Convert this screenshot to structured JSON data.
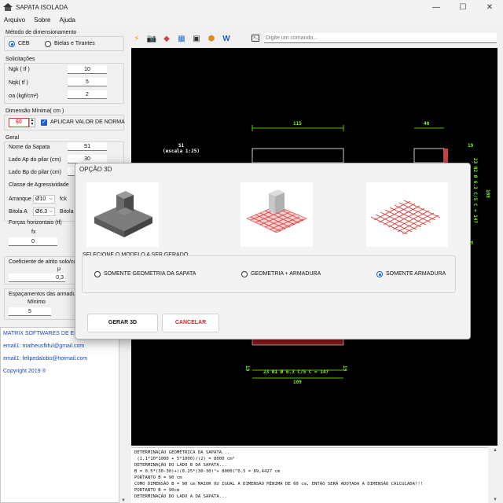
{
  "window": {
    "title": "SAPATA ISOLADA",
    "minimize": "—",
    "maximize": "☐",
    "close": "✕"
  },
  "menu": [
    "Arquivo",
    "Sobre",
    "Ajuda"
  ],
  "left": {
    "metodo": {
      "label": "Método de dimensionamento",
      "ceb": "CEB",
      "bielas": "Bielas e Tirantes",
      "selected": "CEB"
    },
    "solicitacoes": {
      "label": "Solicitações",
      "rows": [
        {
          "label": "Ngk ( tf )",
          "value": "10"
        },
        {
          "label": "Nqk( tf )",
          "value": "5"
        },
        {
          "label": "σa  (kgf/cm²)",
          "value": "2"
        }
      ]
    },
    "dimensao": {
      "label": "Dimensão Mínima( cm )",
      "value": "60",
      "checkbox": "APLICAR VALOR DE NORMA",
      "checked": true
    },
    "geral": {
      "label": "Geral",
      "rows": [
        {
          "label": "Nome da Sapata",
          "value": "S1"
        },
        {
          "label": "Lado Ap do pilar (cm)",
          "value": "30"
        },
        {
          "label": "Lado Bp do pilar (cm)",
          "value": ""
        },
        {
          "label": "Classe de Agressividade",
          "value": ""
        }
      ],
      "arranque_label": "Arranque",
      "arranque_value": "Ø10",
      "fck_label": "fck",
      "bitola_label": "Bitola A",
      "bitola_value": "Ø6.3",
      "bitola_b_label": "Bitola"
    },
    "forcas": {
      "label": "Forças horizontais (tf)",
      "fx_label": "fx",
      "fx_value": "0"
    },
    "atrito": {
      "label": "Coeficiente de atrito solo/co",
      "mu_label": "μ",
      "mu_value": "0,3"
    },
    "espacamentos": {
      "label": "Espaçamentos das armadu",
      "min_label": "Mínimo",
      "min_value": "5"
    },
    "info": [
      "MATRIX SOFTWARES DE EN",
      "email1: matheusfkful@gmail.com",
      "email1: felipedalobo@hotmail.com",
      "Copyright 2019 ®"
    ]
  },
  "toolbar": {
    "icons": [
      "lightning-icon",
      "camera-icon",
      "eraser-icon",
      "calculator-icon",
      "pdf-icon",
      "cube-icon",
      "word-icon"
    ],
    "glyphs": [
      "⚡",
      "📷",
      "◆",
      "▦",
      "▣",
      "⬢",
      "W"
    ],
    "command_placeholder": "Digite um comando...",
    "command_icon": ">_"
  },
  "drawing": {
    "top_dims": [
      "115",
      "40"
    ],
    "sapata_label": "S1",
    "scale_label": "(escala 1:25)",
    "right_dims": [
      "19",
      "100",
      "23 N2 Ø 6.3 C/5 C = 147",
      "19"
    ],
    "bottom_bar": "23 N1 Ø 6.3 C/5 C = 147",
    "bottom_side": [
      "19",
      "19"
    ],
    "bottom_dim": "109"
  },
  "console": [
    "DETERMINAÇÃO GEOMÉTRICA DA SAPATA...",
    " (1,1*10*1000 + 5*1000)/(2) = 8000 cm²",
    "DETERMINAÇÃO DO LADO B DA SAPATA...",
    "B = 0.5*(30-30)+((0.25*(30-30)²+ 8000)^0.5 = 89,4427 cm",
    "PORTANTO B = 90 cm",
    "COMO DIMENSÃO B = 90 cm MAIOR OU IGUAL A DIMENSÃO MÍNIMA DE 60 cm, ENTÃO SERÁ ADOTADA A DIMENSÃO CALCULADA!!!",
    "PORTANTO B = 90cm",
    "DETERMINAÇÃO DO LADO A DA SAPATA..."
  ],
  "dialog": {
    "title": "OPÇÃO 3D",
    "group_label": "SELECIONE O MODELO A SER GERADO",
    "options": [
      "SOMENTE GEOMETRIA DA SAPATA",
      "GEOMETRIA + ARMADURA",
      "SOMENTE ARMADURA"
    ],
    "selected": 2,
    "generate": "GERAR 3D",
    "cancel": "CANCELAR"
  },
  "colors": {
    "accent": "#0a5fc4",
    "cancel": "#e02020",
    "rebar": "#d93a3a",
    "dim": "#7cfc00"
  }
}
